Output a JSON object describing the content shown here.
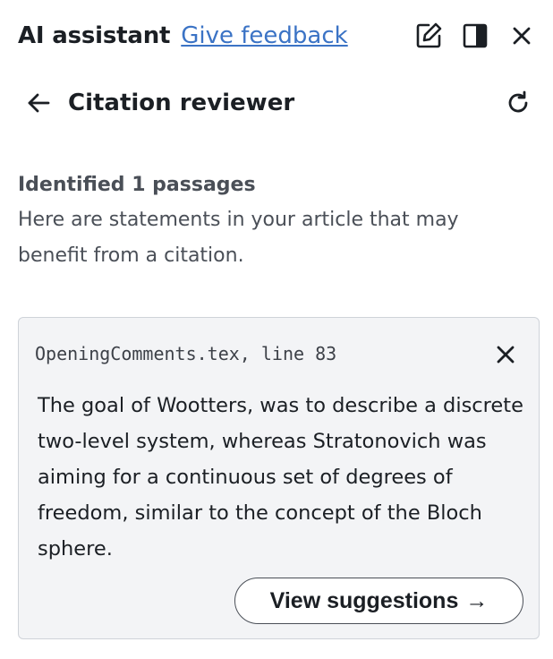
{
  "header": {
    "title": "AI assistant",
    "feedback_link": "Give feedback",
    "icons": [
      "edit-icon",
      "side-panel-icon",
      "close-icon"
    ]
  },
  "subheader": {
    "title": "Citation reviewer",
    "icons": [
      "back-arrow-icon",
      "refresh-icon"
    ]
  },
  "intro": {
    "heading": "Identified 1 passages",
    "text": "Here are statements in your article that may benefit from a citation."
  },
  "card": {
    "location": "OpeningComments.tex, line 83",
    "passage": "The goal of Wootters, was to describe a discrete two-level system, whereas Stratonovich was aiming for a continuous set of degrees of freedom, similar to the concept of the Bloch sphere.",
    "button_label": "View suggestions",
    "button_arrow": "→"
  },
  "colors": {
    "link": "#3b73c5",
    "card_background": "#f3f4f6",
    "card_border": "#cfd3d9",
    "text_primary": "#1b1f24",
    "text_secondary": "#4a4f57"
  }
}
